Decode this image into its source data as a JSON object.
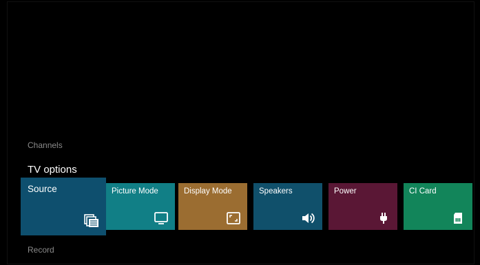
{
  "sections": {
    "channels_label": "Channels",
    "record_label": "Record"
  },
  "tv_options": {
    "title": "TV options",
    "tiles": [
      {
        "label": "Source",
        "icon": "source-icon",
        "color": "#0e4f6e",
        "focused": true
      },
      {
        "label": "Picture Mode",
        "icon": "tv-icon",
        "color": "#117f86"
      },
      {
        "label": "Display Mode",
        "icon": "aspect-ratio-icon",
        "color": "#9b6d31"
      },
      {
        "label": "Speakers",
        "icon": "speaker-icon",
        "color": "#10506b"
      },
      {
        "label": "Power",
        "icon": "power-plug-icon",
        "color": "#5a1735"
      },
      {
        "label": "CI Card",
        "icon": "sim-card-icon",
        "color": "#12855a"
      }
    ]
  }
}
